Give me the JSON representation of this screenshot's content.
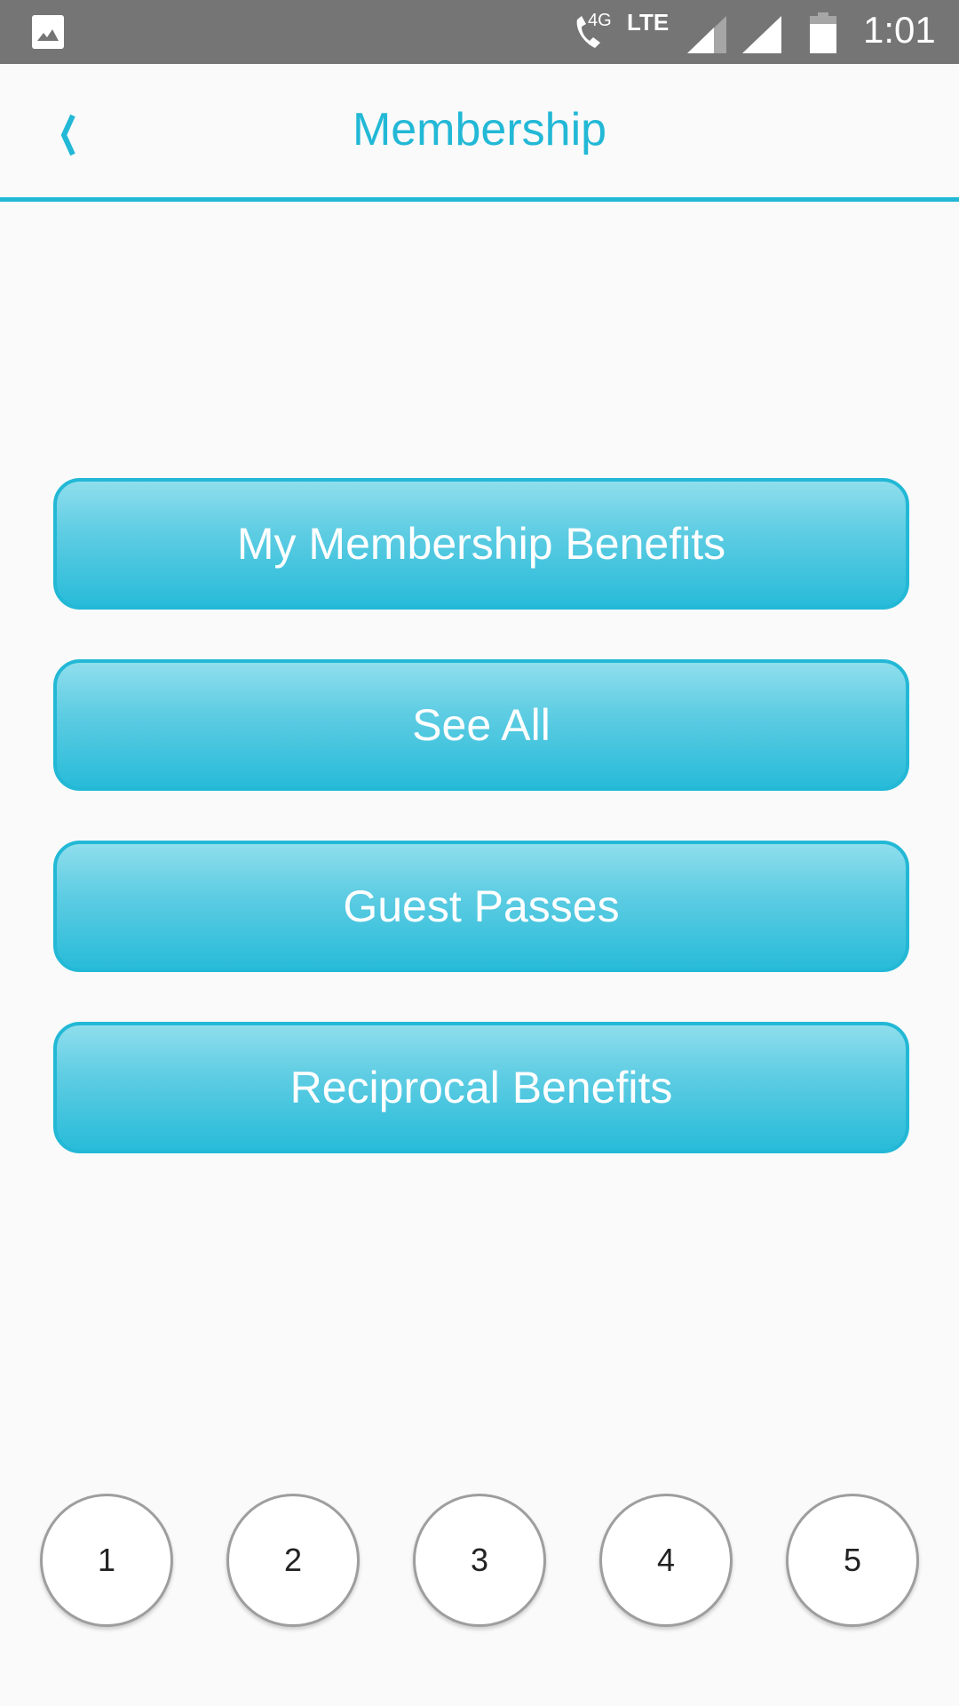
{
  "status_bar": {
    "network_small": "4G",
    "network": "LTE",
    "time": "1:01",
    "icons": [
      "gallery-icon",
      "wifi-call-icon",
      "signal-icon",
      "signal-icon",
      "battery-icon"
    ]
  },
  "header": {
    "title": "Membership",
    "back_icon": "chevron-left-icon",
    "accent_color": "#22b8d6"
  },
  "menu": {
    "buttons": [
      {
        "label": "My Membership Benefits"
      },
      {
        "label": "See All"
      },
      {
        "label": "Guest Passes"
      },
      {
        "label": "Reciprocal Benefits"
      }
    ]
  },
  "pager": {
    "pages": [
      "1",
      "2",
      "3",
      "4",
      "5"
    ]
  }
}
